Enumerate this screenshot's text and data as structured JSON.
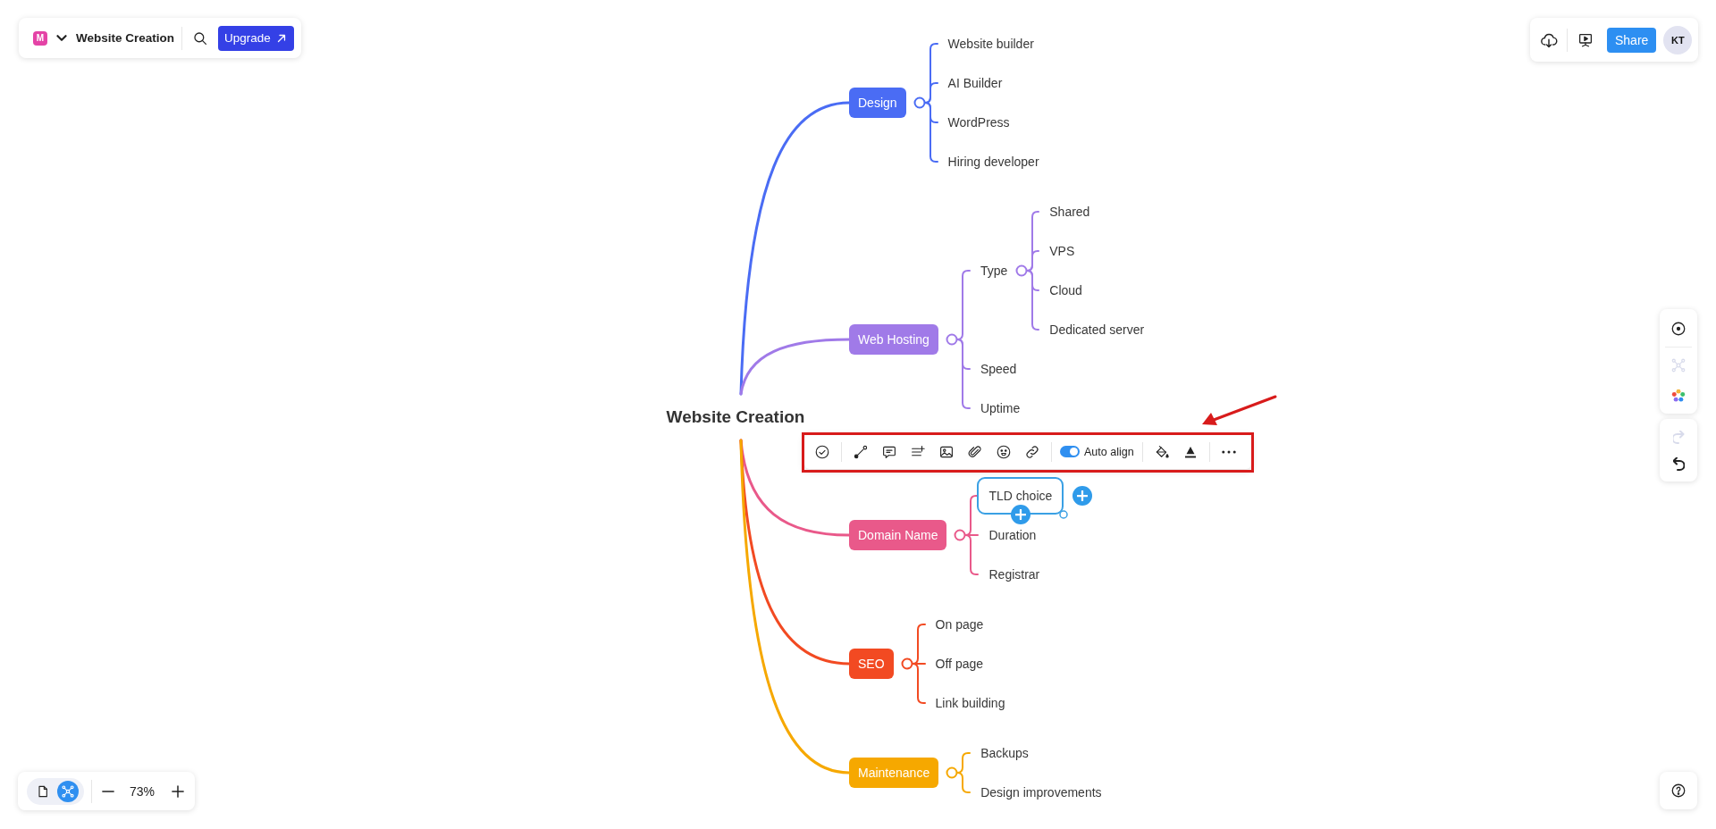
{
  "header": {
    "logo_letter": "M",
    "title": "Website Creation",
    "upgrade_button": "Upgrade"
  },
  "top_right": {
    "share_button": "Share",
    "avatar_initials": "KT"
  },
  "mind_map": {
    "root": {
      "label": "Website Creation",
      "selected": false
    },
    "branches": [
      {
        "label": "Design",
        "color": "#4a6cf4",
        "selected": false,
        "children": [
          {
            "label": "Website builder",
            "selected": false
          },
          {
            "label": "AI Builder",
            "selected": false
          },
          {
            "label": "WordPress",
            "selected": false
          },
          {
            "label": "Hiring developer",
            "selected": false
          }
        ]
      },
      {
        "label": "Web Hosting",
        "color": "#a07ae8",
        "selected": false,
        "children": [
          {
            "label": "Type",
            "selected": false,
            "children": [
              {
                "label": "Shared",
                "selected": false
              },
              {
                "label": "VPS",
                "selected": false
              },
              {
                "label": "Cloud",
                "selected": false
              },
              {
                "label": "Dedicated server",
                "selected": false
              }
            ]
          },
          {
            "label": "Speed",
            "selected": false
          },
          {
            "label": "Uptime",
            "selected": false
          }
        ]
      },
      {
        "label": "Domain Name",
        "color": "#e9598a",
        "selected": false,
        "children": [
          {
            "label": "TLD choice",
            "selected": true
          },
          {
            "label": "Duration",
            "selected": false
          },
          {
            "label": "Registrar",
            "selected": false
          }
        ]
      },
      {
        "label": "SEO",
        "color": "#f24a22",
        "selected": false,
        "children": [
          {
            "label": "On page",
            "selected": false
          },
          {
            "label": "Off page",
            "selected": false
          },
          {
            "label": "Link building",
            "selected": false
          }
        ]
      },
      {
        "label": "Maintenance",
        "color": "#f6a800",
        "selected": false,
        "children": [
          {
            "label": "Backups",
            "selected": false
          },
          {
            "label": "Design improvements",
            "selected": false
          }
        ]
      }
    ]
  },
  "node_toolbar": {
    "auto_align": {
      "label": "Auto align",
      "on": true
    }
  },
  "side_tools": [
    {
      "kind": "focus",
      "disabled": false
    },
    {
      "kind": "layout",
      "disabled": true
    },
    {
      "kind": "palette",
      "disabled": false
    }
  ],
  "history": [
    {
      "kind": "redo",
      "disabled": true
    },
    {
      "kind": "undo",
      "disabled": false
    }
  ],
  "view_switch": [
    {
      "kind": "document",
      "selected": false
    },
    {
      "kind": "mind-map",
      "selected": true
    }
  ],
  "zoom": {
    "value": "73%"
  }
}
